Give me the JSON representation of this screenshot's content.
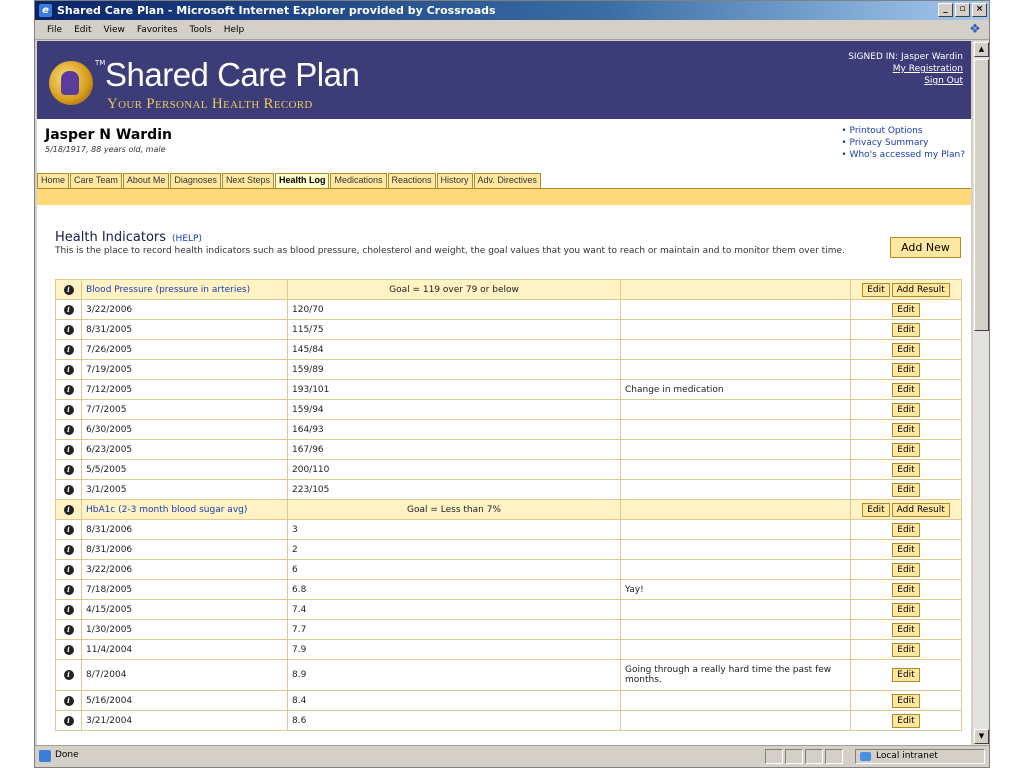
{
  "window": {
    "title": "Shared Care Plan - Microsoft Internet Explorer provided by Crossroads",
    "controls": [
      "_",
      "▫",
      "×"
    ]
  },
  "menu": [
    "File",
    "Edit",
    "View",
    "Favorites",
    "Tools",
    "Help"
  ],
  "banner": {
    "title": "Shared Care Plan",
    "subtitle": "Your Personal Health Record",
    "tm": "TM",
    "signed_in": "SIGNED IN: Jasper Wardin",
    "my_registration": "My Registration",
    "sign_out": "Sign Out"
  },
  "patient": {
    "name": "Jasper N Wardin",
    "info": "5/18/1917, 88 years old, male",
    "links": [
      "Printout Options",
      "Privacy Summary",
      "Who's accessed my Plan?"
    ]
  },
  "tabs": [
    "Home",
    "Care Team",
    "About Me",
    "Diagnoses",
    "Next Steps",
    "Health Log",
    "Medications",
    "Reactions",
    "History",
    "Adv. Directives"
  ],
  "active_tab": "Health Log",
  "health": {
    "title": "Health Indicators",
    "help": "(HELP)",
    "description": "This is the place to record health indicators such as blood pressure, cholesterol and weight, the goal values that you want to reach or maintain and to monitor them over time.",
    "add_new": "Add New",
    "edit_label": "Edit",
    "add_result_label": "Add Result",
    "info_glyph": "i",
    "groups": [
      {
        "name": "Blood Pressure (pressure in arteries)",
        "goal": "Goal = 119 over 79 or below",
        "rows": [
          {
            "date": "3/22/2006",
            "value": "120/70",
            "note": ""
          },
          {
            "date": "8/31/2005",
            "value": "115/75",
            "note": ""
          },
          {
            "date": "7/26/2005",
            "value": "145/84",
            "note": ""
          },
          {
            "date": "7/19/2005",
            "value": "159/89",
            "note": ""
          },
          {
            "date": "7/12/2005",
            "value": "193/101",
            "note": "Change in medication"
          },
          {
            "date": "7/7/2005",
            "value": "159/94",
            "note": ""
          },
          {
            "date": "6/30/2005",
            "value": "164/93",
            "note": ""
          },
          {
            "date": "6/23/2005",
            "value": "167/96",
            "note": ""
          },
          {
            "date": "5/5/2005",
            "value": "200/110",
            "note": ""
          },
          {
            "date": "3/1/2005",
            "value": "223/105",
            "note": ""
          }
        ]
      },
      {
        "name": "HbA1c (2-3 month blood sugar avg)",
        "goal": "Goal = Less than 7%",
        "rows": [
          {
            "date": "8/31/2006",
            "value": "3",
            "note": ""
          },
          {
            "date": "8/31/2006",
            "value": "2",
            "note": ""
          },
          {
            "date": "3/22/2006",
            "value": "6",
            "note": ""
          },
          {
            "date": "7/18/2005",
            "value": "6.8",
            "note": "Yay!"
          },
          {
            "date": "4/15/2005",
            "value": "7.4",
            "note": ""
          },
          {
            "date": "1/30/2005",
            "value": "7.7",
            "note": ""
          },
          {
            "date": "11/4/2004",
            "value": "7.9",
            "note": ""
          },
          {
            "date": "8/7/2004",
            "value": "8.9",
            "note": "Going through a really hard time the past few months."
          },
          {
            "date": "5/16/2004",
            "value": "8.4",
            "note": ""
          },
          {
            "date": "3/21/2004",
            "value": "8.6",
            "note": ""
          }
        ]
      }
    ]
  },
  "status": {
    "done": "Done",
    "zone": "Local intranet"
  }
}
